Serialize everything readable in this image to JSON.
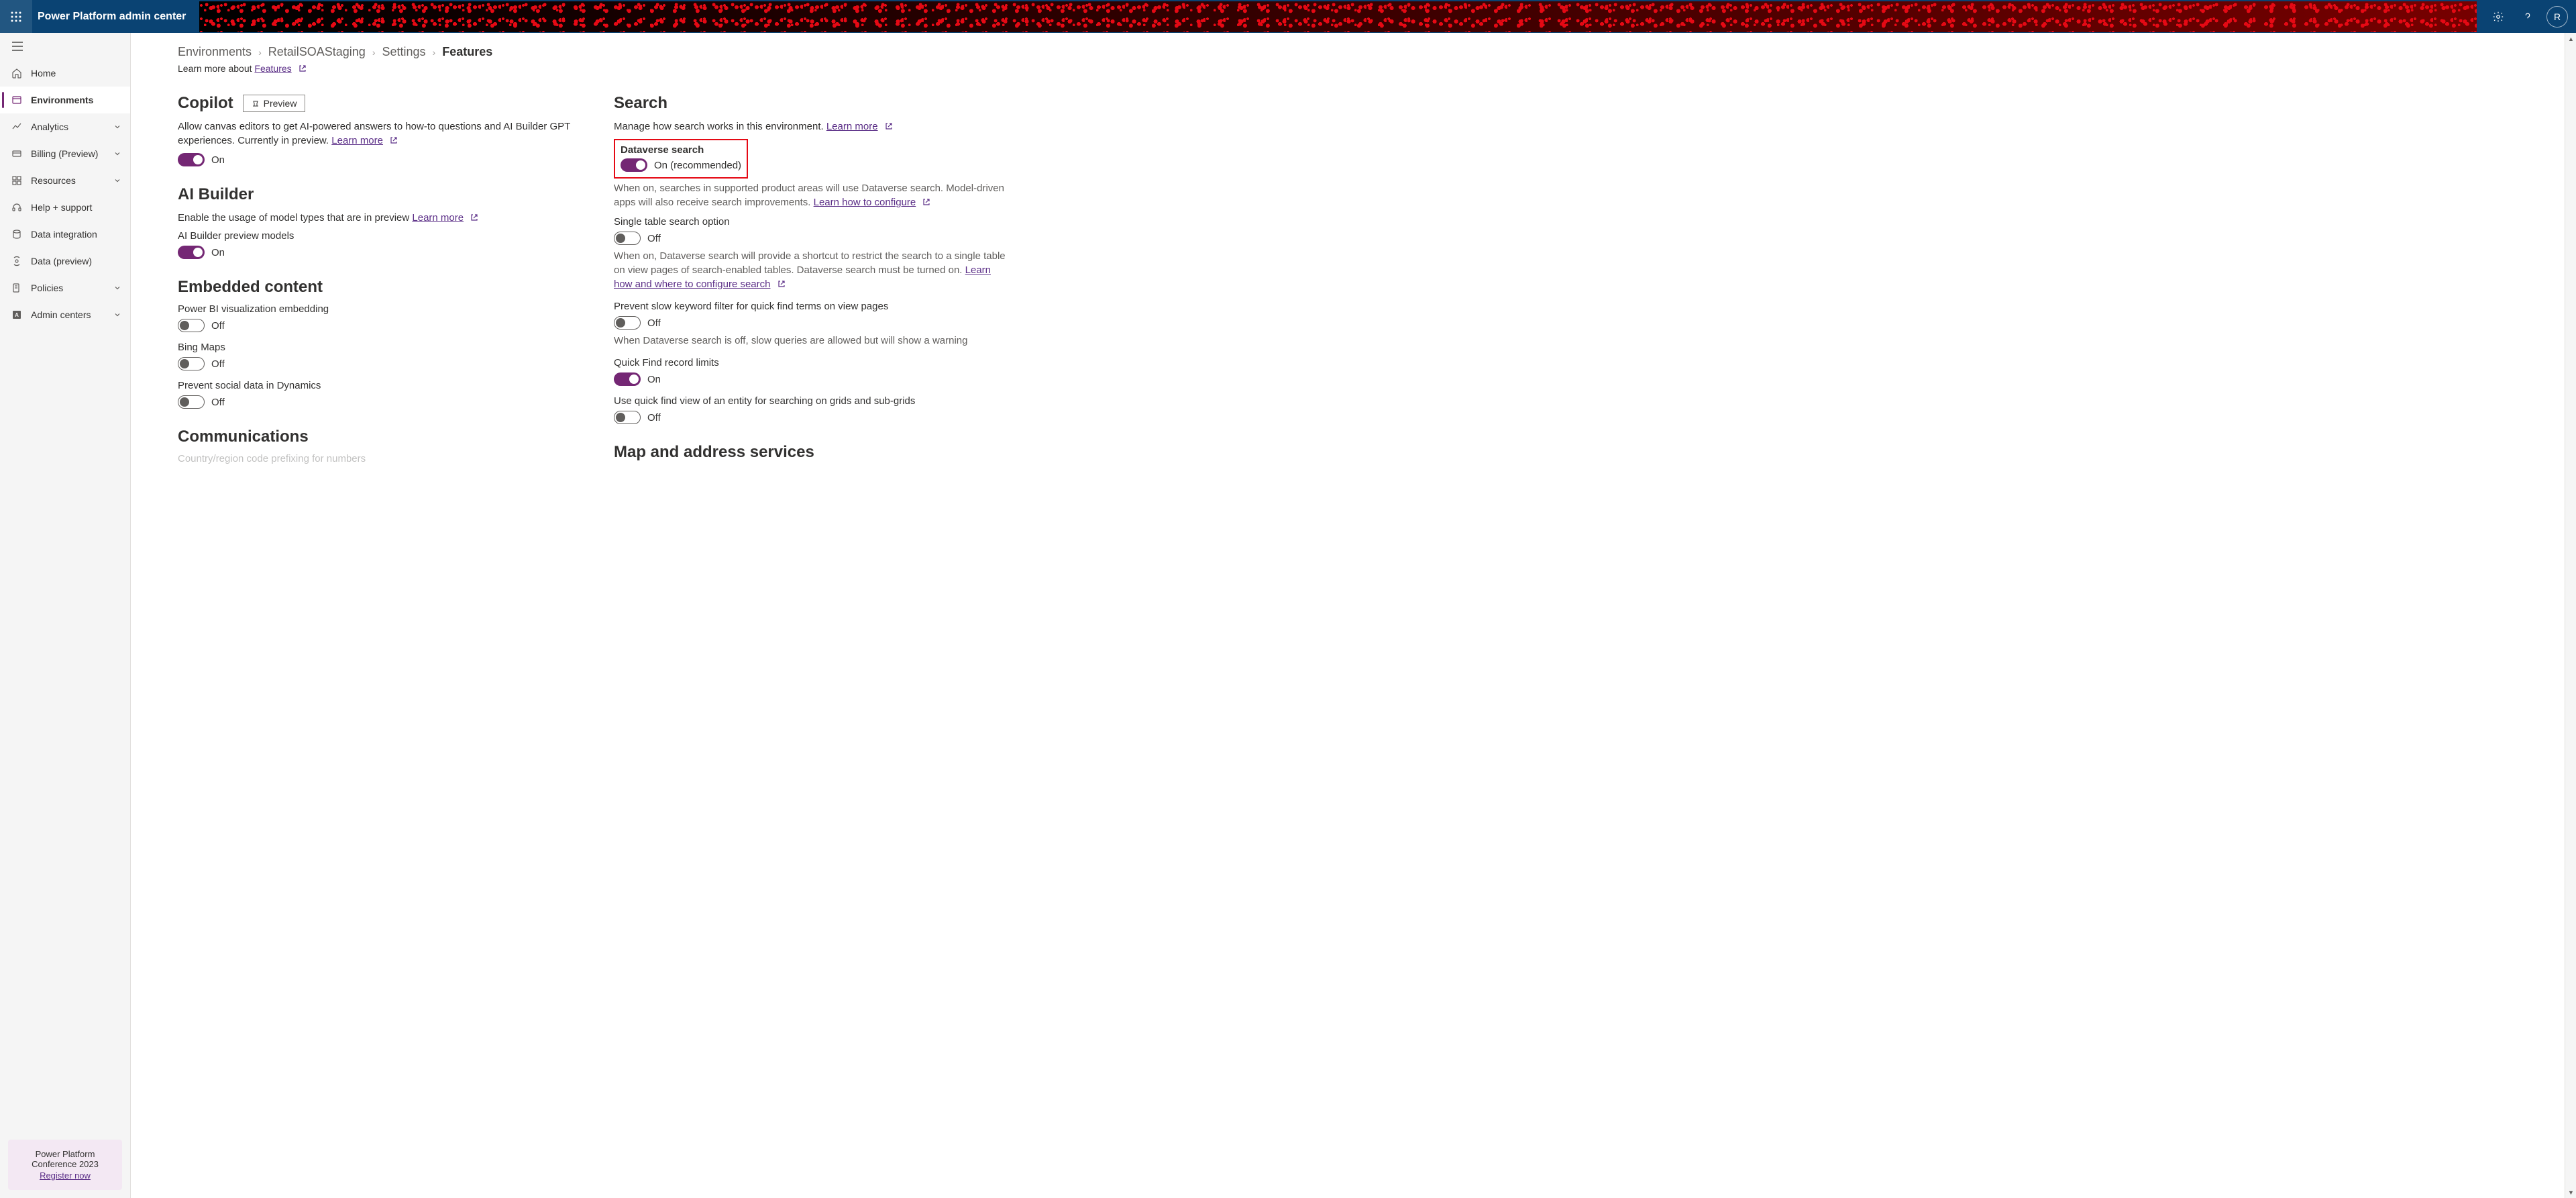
{
  "header": {
    "app_title": "Power Platform admin center",
    "avatar_initial": "R"
  },
  "nav": {
    "items": [
      {
        "label": "Home",
        "icon": "home",
        "expandable": false
      },
      {
        "label": "Environments",
        "icon": "environments",
        "expandable": false,
        "selected": true
      },
      {
        "label": "Analytics",
        "icon": "analytics",
        "expandable": true
      },
      {
        "label": "Billing (Preview)",
        "icon": "billing",
        "expandable": true
      },
      {
        "label": "Resources",
        "icon": "resources",
        "expandable": true
      },
      {
        "label": "Help + support",
        "icon": "help",
        "expandable": false
      },
      {
        "label": "Data integration",
        "icon": "dataintegration",
        "expandable": false
      },
      {
        "label": "Data (preview)",
        "icon": "datapreview",
        "expandable": false
      },
      {
        "label": "Policies",
        "icon": "policies",
        "expandable": true
      },
      {
        "label": "Admin centers",
        "icon": "admincenters",
        "expandable": true
      }
    ],
    "promo": {
      "line1": "Power Platform",
      "line2": "Conference 2023",
      "link": "Register now"
    }
  },
  "breadcrumb": {
    "items": [
      "Environments",
      "RetailSOAStaging",
      "Settings"
    ],
    "current": "Features"
  },
  "learn_more_row": {
    "prefix": "Learn more about ",
    "link": "Features"
  },
  "left_col": {
    "copilot": {
      "title": "Copilot",
      "preview_label": "Preview",
      "desc_before": "Allow canvas editors to get AI-powered answers to how-to questions and AI Builder GPT experiences. Currently in preview. ",
      "learn_more": "Learn more",
      "toggle_state": "On"
    },
    "ai_builder": {
      "title": "AI Builder",
      "desc_before": "Enable the usage of model types that are in preview ",
      "learn_more": "Learn more",
      "sub_label": "AI Builder preview models",
      "toggle_state": "On"
    },
    "embedded": {
      "title": "Embedded content",
      "powerbi_label": "Power BI visualization embedding",
      "powerbi_state": "Off",
      "bingmaps_label": "Bing Maps",
      "bingmaps_state": "Off",
      "social_label": "Prevent social data in Dynamics",
      "social_state": "Off"
    },
    "communications": {
      "title": "Communications",
      "next_label": "Country/region code prefixing for numbers"
    }
  },
  "right_col": {
    "search": {
      "title": "Search",
      "desc_before": "Manage how search works in this environment. ",
      "learn_more": "Learn more",
      "dataverse_label": "Dataverse search",
      "dataverse_state": "On (recommended)",
      "dataverse_desc_before": "When on, searches in supported product areas will use Dataverse search. Model-driven apps will also receive search improvements. ",
      "dataverse_link": "Learn how to configure",
      "single_label": "Single table search option",
      "single_state": "Off",
      "single_desc_before": "When on, Dataverse search will provide a shortcut to restrict the search to a single table on view pages of search-enabled tables. Dataverse search must be turned on. ",
      "single_link": "Learn how and where to configure search",
      "slow_label": "Prevent slow keyword filter for quick find terms on view pages",
      "slow_state": "Off",
      "slow_desc": "When Dataverse search is off, slow queries are allowed but will show a warning",
      "quickfind_label": "Quick Find record limits",
      "quickfind_state": "On",
      "quickview_label": "Use quick find view of an entity for searching on grids and sub-grids",
      "quickview_state": "Off"
    },
    "map": {
      "title": "Map and address services"
    }
  }
}
